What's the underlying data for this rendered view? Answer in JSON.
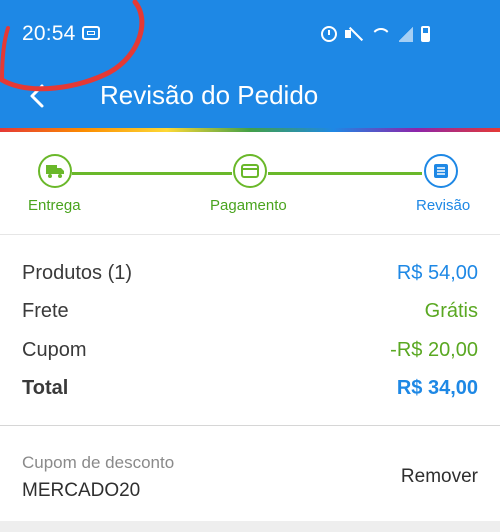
{
  "status_bar": {
    "time": "20:54",
    "icons": [
      "notification-icon",
      "alarm-icon",
      "mute-icon",
      "wifi-icon",
      "signal-icon",
      "battery-icon"
    ]
  },
  "header": {
    "title": "Revisão do Pedido",
    "back_icon": "back-arrow-icon",
    "color": "#1e88e5"
  },
  "stepper": {
    "steps": [
      {
        "label": "Entrega",
        "icon": "truck-icon",
        "state": "done"
      },
      {
        "label": "Pagamento",
        "icon": "card-icon",
        "state": "done"
      },
      {
        "label": "Revisão",
        "icon": "list-icon",
        "state": "active"
      }
    ],
    "done_color": "#6ab82a",
    "active_color": "#1e88e5"
  },
  "summary": {
    "rows": [
      {
        "label": "Produtos (1)",
        "value": "R$ 54,00",
        "color": "#1e88e5"
      },
      {
        "label": "Frete",
        "value": "Grátis",
        "color": "#5aa822"
      },
      {
        "label": "Cupom",
        "value": "-R$ 20,00",
        "color": "#5aa822"
      },
      {
        "label": "Total",
        "value": "R$ 34,00",
        "color": "#1e88e5"
      }
    ]
  },
  "coupon": {
    "caption": "Cupom de desconto",
    "code": "MERCADO20",
    "remove_label": "Remover"
  }
}
